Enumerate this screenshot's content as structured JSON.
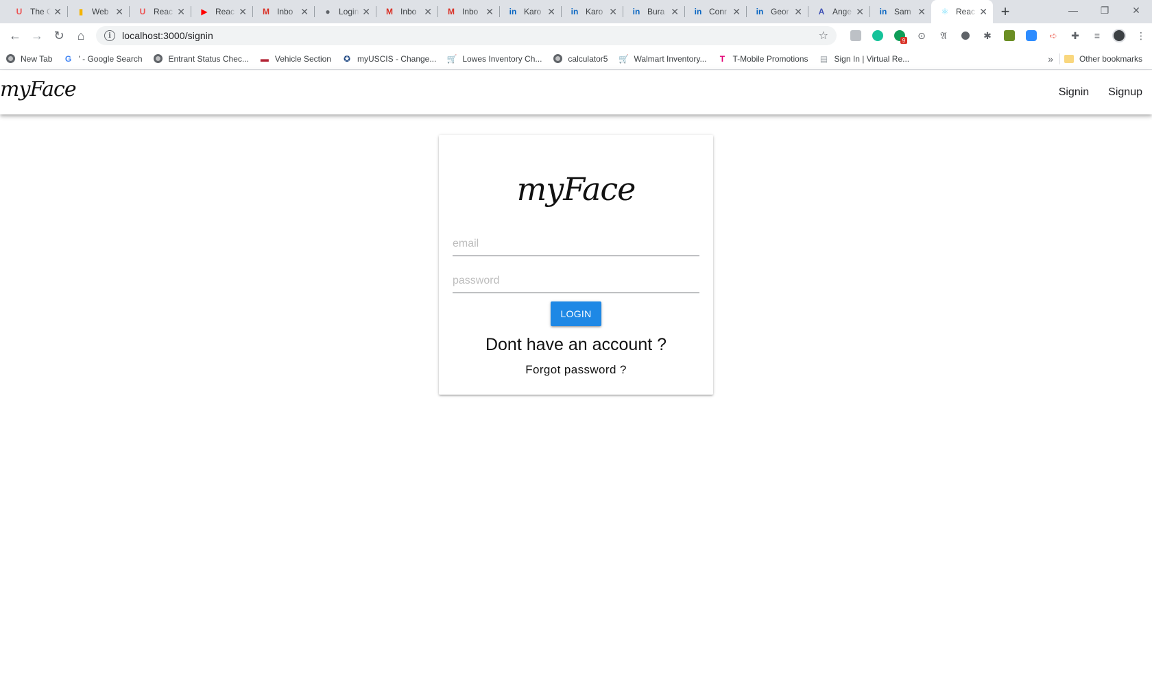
{
  "browser": {
    "tabs": [
      {
        "title": "The C",
        "favicon": "udemy-icon",
        "color": "#ec5252",
        "glyph": "U",
        "active": false
      },
      {
        "title": "Web",
        "favicon": "web-icon",
        "color": "#f4b400",
        "glyph": "▮",
        "active": false
      },
      {
        "title": "Reac",
        "favicon": "udemy-icon",
        "color": "#ec5252",
        "glyph": "U",
        "active": false
      },
      {
        "title": "Reac",
        "favicon": "youtube-icon",
        "color": "#ff0000",
        "glyph": "▶",
        "active": false
      },
      {
        "title": "Inbo",
        "favicon": "gmail-icon",
        "color": "#d93025",
        "glyph": "M",
        "active": false
      },
      {
        "title": "Login",
        "favicon": "globe-icon",
        "color": "#5f6368",
        "glyph": "●",
        "active": false
      },
      {
        "title": "Inbo",
        "favicon": "gmail-icon",
        "color": "#d93025",
        "glyph": "M",
        "active": false
      },
      {
        "title": "Inbo",
        "favicon": "gmail-icon",
        "color": "#d93025",
        "glyph": "M",
        "active": false
      },
      {
        "title": "Karo",
        "favicon": "linkedin-icon",
        "color": "#0a66c2",
        "glyph": "in",
        "active": false
      },
      {
        "title": "Karo",
        "favicon": "linkedin-icon",
        "color": "#0a66c2",
        "glyph": "in",
        "active": false
      },
      {
        "title": "Bura",
        "favicon": "linkedin-icon",
        "color": "#0a66c2",
        "glyph": "in",
        "active": false
      },
      {
        "title": "Conr",
        "favicon": "linkedin-icon",
        "color": "#0a66c2",
        "glyph": "in",
        "active": false
      },
      {
        "title": "Geor",
        "favicon": "linkedin-icon",
        "color": "#0a66c2",
        "glyph": "in",
        "active": false
      },
      {
        "title": "Ange",
        "favicon": "angular-icon",
        "color": "#3f51b5",
        "glyph": "A",
        "active": false
      },
      {
        "title": "Sam",
        "favicon": "linkedin-icon",
        "color": "#0a66c2",
        "glyph": "in",
        "active": false
      },
      {
        "title": "Reac",
        "favicon": "react-icon",
        "color": "#61dafb",
        "glyph": "⚛",
        "active": true
      }
    ],
    "address": "localhost:3000/signin",
    "bookmarks": [
      {
        "label": "New Tab",
        "icon": "globe-icon"
      },
      {
        "label": "' - Google Search",
        "icon": "google-icon"
      },
      {
        "label": "Entrant Status Chec...",
        "icon": "globe-icon"
      },
      {
        "label": "Vehicle Section",
        "icon": "flag-icon"
      },
      {
        "label": "myUSCIS - Change...",
        "icon": "seal-icon"
      },
      {
        "label": "Lowes Inventory Ch...",
        "icon": "cart-icon"
      },
      {
        "label": "calculator5",
        "icon": "globe-icon"
      },
      {
        "label": "Walmart Inventory...",
        "icon": "cart-icon"
      },
      {
        "label": "T-Mobile Promotions",
        "icon": "tmobile-icon"
      },
      {
        "label": "Sign In | Virtual Re...",
        "icon": "doc-icon"
      }
    ],
    "other_bookmarks": "Other bookmarks"
  },
  "app": {
    "brand": "myFace",
    "nav": {
      "signin": "Signin",
      "signup": "Signup"
    }
  },
  "signin": {
    "logo": "myFace",
    "email_placeholder": "email",
    "password_placeholder": "password",
    "login_label": "LOGIN",
    "no_account": "Dont have an account ?",
    "forgot": "Forgot password ?"
  },
  "colors": {
    "primary": "#1e88e5",
    "react": "#61dafb"
  }
}
